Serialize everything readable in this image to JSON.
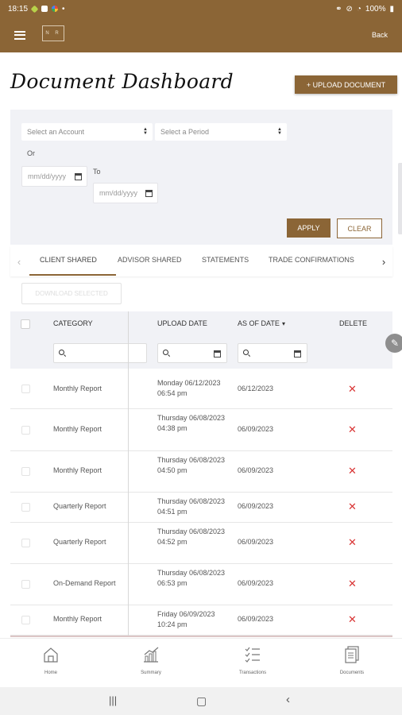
{
  "status_bar": {
    "time": "18:15",
    "battery": "100%"
  },
  "app_bar": {
    "logo_text": "N R",
    "back_label": "Back"
  },
  "page": {
    "title": "Document Dashboard",
    "upload_button": "+ UPLOAD DOCUMENT"
  },
  "filters": {
    "account_placeholder": "Select an Account",
    "period_placeholder": "Select a Period",
    "or_label": "Or",
    "to_label": "To",
    "from_date_placeholder": "mm/dd/yyyy",
    "to_date_placeholder": "mm/dd/yyyy",
    "apply_label": "APPLY",
    "clear_label": "CLEAR"
  },
  "tabs": [
    {
      "label": "CLIENT SHARED",
      "active": true
    },
    {
      "label": "ADVISOR SHARED",
      "active": false
    },
    {
      "label": "STATEMENTS",
      "active": false
    },
    {
      "label": "TRADE CONFIRMATIONS",
      "active": false
    }
  ],
  "download_selected_label": "DOWNLOAD SELECTED",
  "table": {
    "columns": {
      "category": "CATEGORY",
      "upload_date": "UPLOAD DATE",
      "as_of_date": "AS OF DATE",
      "sort_indicator": "▾",
      "delete": "DELETE"
    },
    "rows": [
      {
        "category": "Monthly Report",
        "upload_date": "Monday 06/12/2023 06:54 pm",
        "as_of_date": "06/12/2023",
        "delete_icon": "✕"
      },
      {
        "category": "Monthly Report",
        "upload_date": "Thursday 06/08/2023 04:38 pm",
        "as_of_date": "06/09/2023",
        "delete_icon": "✕"
      },
      {
        "category": "Monthly Report",
        "upload_date": "Thursday 06/08/2023 04:50 pm",
        "as_of_date": "06/09/2023",
        "delete_icon": "✕"
      },
      {
        "category": "Quarterly Report",
        "upload_date": "Thursday 06/08/2023 04:51 pm",
        "as_of_date": "06/09/2023",
        "delete_icon": "✕"
      },
      {
        "category": "Quarterly Report",
        "upload_date": "Thursday 06/08/2023 04:52 pm",
        "as_of_date": "06/09/2023",
        "delete_icon": "✕"
      },
      {
        "category": "On-Demand Report",
        "upload_date": "Thursday 06/08/2023 06:53 pm",
        "as_of_date": "06/09/2023",
        "delete_icon": "✕"
      },
      {
        "category": "Monthly Report",
        "upload_date": "Friday 06/09/2023 10:24 pm",
        "as_of_date": "06/09/2023",
        "delete_icon": "✕"
      }
    ]
  },
  "bottom_nav": {
    "home": "Home",
    "summary": "Summary",
    "transactions": "Transactions",
    "documents": "Documents"
  },
  "colors": {
    "brand": "#8b6536",
    "panel": "#f1f2f6",
    "delete": "#d93434"
  }
}
